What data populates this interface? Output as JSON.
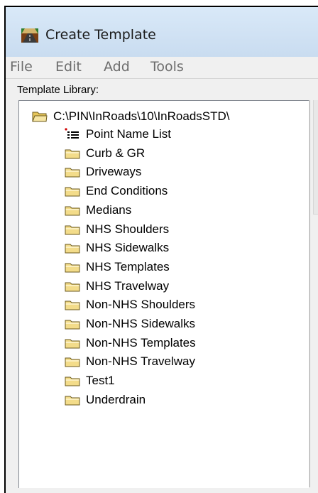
{
  "window": {
    "title": "Create Template",
    "menu": [
      "File",
      "Edit",
      "Add",
      "Tools"
    ]
  },
  "library": {
    "label": "Template Library:",
    "root_path": "C:\\PIN\\InRoads\\10\\InRoadsSTD\\",
    "items": [
      {
        "label": "Point Name List",
        "icon": "list-icon"
      },
      {
        "label": "Curb & GR",
        "icon": "folder-icon"
      },
      {
        "label": "Driveways",
        "icon": "folder-icon"
      },
      {
        "label": "End Conditions",
        "icon": "folder-icon"
      },
      {
        "label": "Medians",
        "icon": "folder-icon"
      },
      {
        "label": "NHS Shoulders",
        "icon": "folder-icon"
      },
      {
        "label": "NHS Sidewalks",
        "icon": "folder-icon"
      },
      {
        "label": "NHS Templates",
        "icon": "folder-icon"
      },
      {
        "label": "NHS Travelway",
        "icon": "folder-icon"
      },
      {
        "label": "Non-NHS Shoulders",
        "icon": "folder-icon"
      },
      {
        "label": "Non-NHS Sidewalks",
        "icon": "folder-icon"
      },
      {
        "label": "Non-NHS Templates",
        "icon": "folder-icon"
      },
      {
        "label": "Non-NHS Travelway",
        "icon": "folder-icon"
      },
      {
        "label": "Test1",
        "icon": "folder-icon"
      },
      {
        "label": "Underdrain",
        "icon": "folder-icon"
      }
    ]
  },
  "colors": {
    "titlebar": "#d4e5f7",
    "folder": "#f3dc8a"
  }
}
